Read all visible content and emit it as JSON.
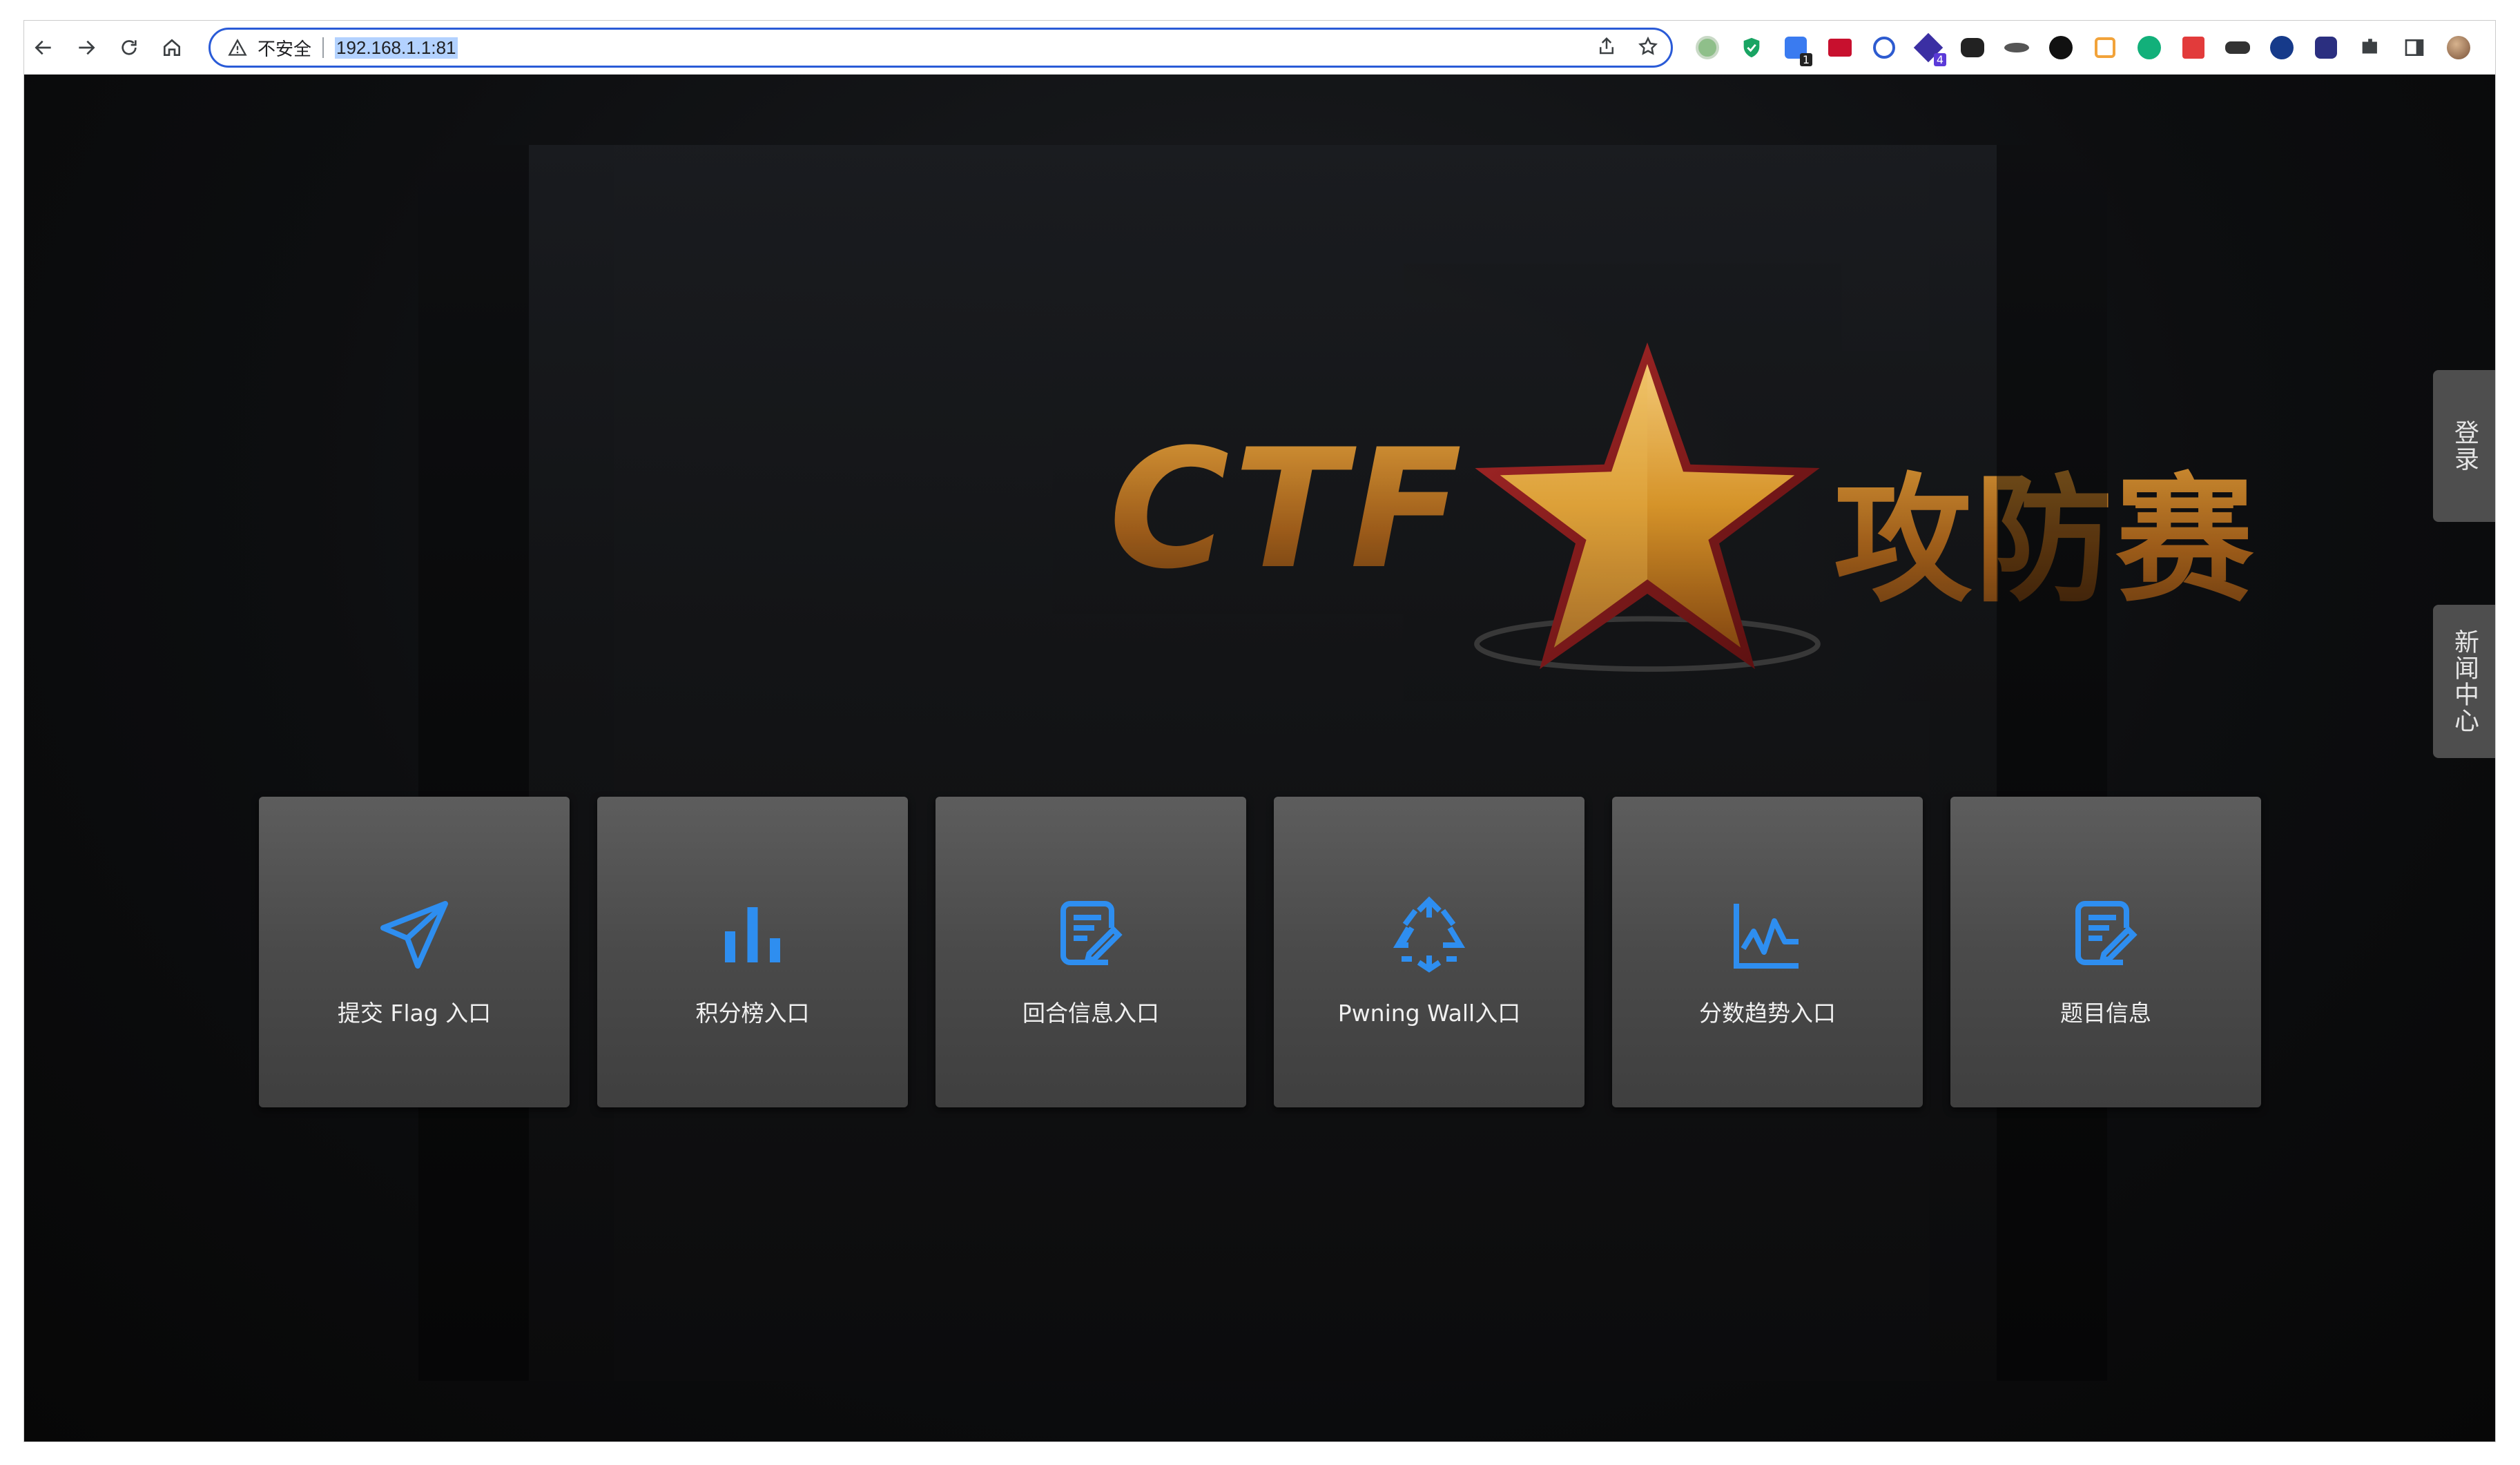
{
  "browser": {
    "security_label": "不安全",
    "url": "192.168.1.1:81",
    "icons": [
      "back-icon",
      "forward-icon",
      "reload-icon",
      "home-icon",
      "share-icon",
      "bookmark-star-icon"
    ],
    "extensions": [
      "extension-green-circle",
      "extension-shield",
      "extension-translate",
      "extension-red",
      "extension-chat",
      "extension-purple",
      "extension-bear",
      "extension-hat",
      "extension-s",
      "extension-orange",
      "extension-refresh",
      "extension-fe",
      "extension-glasses",
      "extension-check",
      "extension-stack",
      "puzzle-icon",
      "sidebar-icon",
      "avatar",
      "menu-icon"
    ],
    "extension_badges": {
      "extension-translate": "1",
      "extension-purple": "4"
    }
  },
  "hero": {
    "left_text": "CTF",
    "right_text": "攻防赛",
    "colors": {
      "gold": "#e8a43b",
      "red": "#8b1a1a"
    }
  },
  "tiles": [
    {
      "label": "提交 Flag 入口",
      "icon": "paper-plane-icon"
    },
    {
      "label": "积分榜入口",
      "icon": "bar-chart-icon"
    },
    {
      "label": "回合信息入口",
      "icon": "document-edit-icon"
    },
    {
      "label": "Pwning Wall入口",
      "icon": "recycle-icon"
    },
    {
      "label": "分数趋势入口",
      "icon": "line-chart-icon"
    },
    {
      "label": "题目信息",
      "icon": "document-edit-icon"
    }
  ],
  "sidebar": {
    "login": "登录",
    "news": "新闻中心"
  },
  "accent": "#2e8ef0"
}
